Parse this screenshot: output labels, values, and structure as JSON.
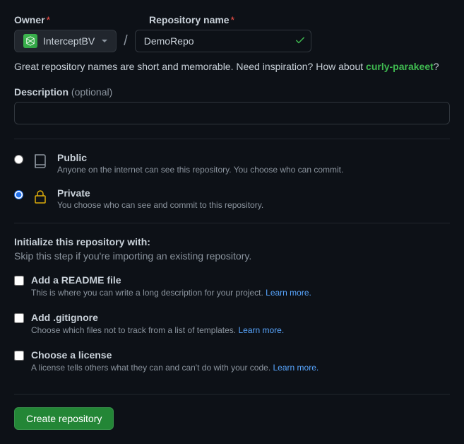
{
  "labels": {
    "owner": "Owner",
    "repo_name": "Repository name",
    "description": "Description",
    "optional": "(optional)",
    "required": "*"
  },
  "owner": {
    "name": "InterceptBV"
  },
  "repo": {
    "value": "DemoRepo"
  },
  "helper": {
    "prefix": "Great repository names are short and memorable. Need inspiration? How about ",
    "suggestion": "curly-parakeet",
    "suffix": "?"
  },
  "separator": "/",
  "visibility": {
    "public": {
      "title": "Public",
      "desc": "Anyone on the internet can see this repository. You choose who can commit."
    },
    "private": {
      "title": "Private",
      "desc": "You choose who can see and commit to this repository."
    }
  },
  "init": {
    "heading": "Initialize this repository with:",
    "skip": "Skip this step if you're importing an existing repository.",
    "readme": {
      "label": "Add a README file",
      "desc": "This is where you can write a long description for your project. ",
      "link": "Learn more."
    },
    "gitignore": {
      "label": "Add .gitignore",
      "desc": "Choose which files not to track from a list of templates. ",
      "link": "Learn more."
    },
    "license": {
      "label": "Choose a license",
      "desc": "A license tells others what they can and can't do with your code. ",
      "link": "Learn more."
    }
  },
  "buttons": {
    "create": "Create repository"
  }
}
